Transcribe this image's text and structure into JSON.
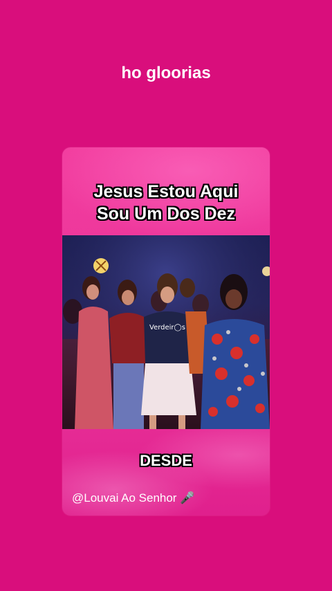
{
  "header": {
    "title": "ho gloorias"
  },
  "card": {
    "caption_line1": "Jesus Estou Aqui",
    "caption_line2": "Sou Um Dos Dez",
    "lower_word": "DESDE",
    "credit": "@Louvai Ao Senhor 🎤",
    "shirt_text": "Verdeir◯s"
  },
  "colors": {
    "background": "#d90e7c",
    "card": "#ea339a",
    "text": "#ffffff"
  }
}
